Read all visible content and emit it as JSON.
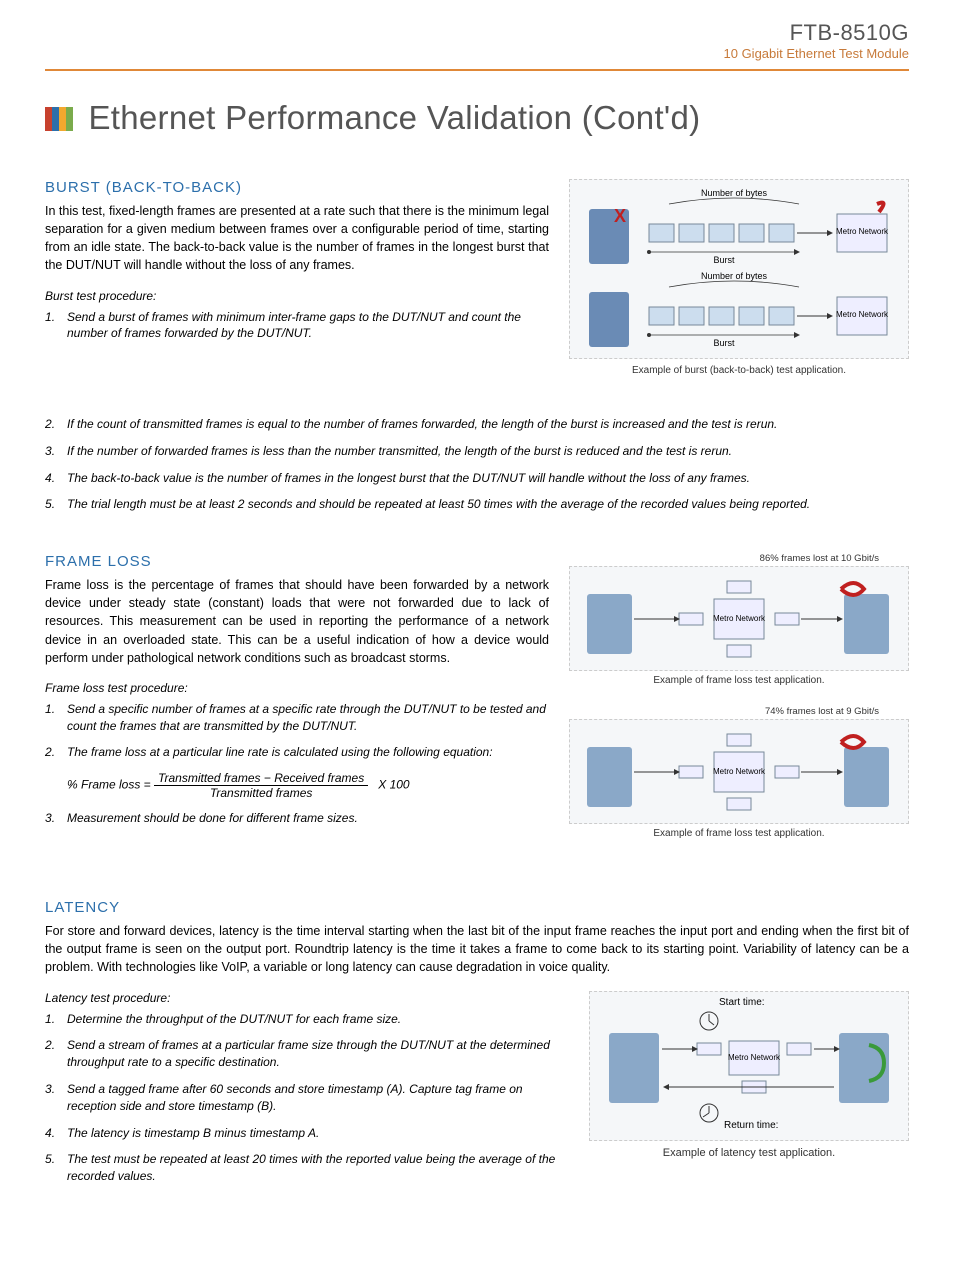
{
  "header": {
    "product_code": "FTB-8510G",
    "product_desc": "10 Gigabit Ethernet Test Module"
  },
  "page_title": "Ethernet Performance Validation (Cont'd)",
  "burst": {
    "heading": "BURST (BACK-TO-BACK)",
    "body": "In this test, fixed-length frames are presented at a rate such that there is the minimum legal separation for a given medium between frames over a configurable period of time, starting from an idle state. The back-to-back value is the number of frames in the longest burst that the DUT/NUT will handle without the loss of any frames.",
    "procedure_title": "Burst test procedure:",
    "steps": [
      "Send a burst of frames with minimum inter-frame gaps to the DUT/NUT and count the number of frames forwarded by the DUT/NUT.",
      "If the count of transmitted frames is equal to the number of frames forwarded, the length of the burst is increased and the test is rerun.",
      "If the number of forwarded frames is less than the number transmitted, the length of the burst is reduced and the test is rerun.",
      "The back-to-back value is the number of frames in the longest burst that the DUT/NUT will handle without the loss of any frames.",
      "The trial length must be at least 2 seconds and should be repeated at least 50 times with the average of the recorded values being reported."
    ],
    "diagram_labels": {
      "top": "Number of bytes",
      "burst": "Burst",
      "metro": "Metro Network"
    },
    "caption": "Example of burst (back-to-back) test application."
  },
  "frame_loss": {
    "heading": "FRAME LOSS",
    "body": "Frame loss is the percentage of frames that should have been forwarded by a network device under steady state (constant) loads that were not forwarded due to lack of resources. This measurement can be used in reporting the performance of a network device in an overloaded state. This can be a useful indication of how a device would perform under pathological network conditions such as broadcast storms.",
    "procedure_title": "Frame loss test procedure:",
    "step1": "Send a specific number of frames at a specific rate through the DUT/NUT to be tested and count the frames that are transmitted by the DUT/NUT.",
    "step2": "The frame loss at a particular line rate is calculated using the following equation:",
    "eq_lhs": "% Frame loss =",
    "eq_num": "Transmitted frames − Received frames",
    "eq_den": "Transmitted frames",
    "eq_tail": "X 100",
    "step3": "Measurement should be done for different frame sizes.",
    "annot1": "86% frames lost at 10 Gbit/s",
    "annot2": "74% frames lost at 9 Gbit/s",
    "metro": "Metro Network",
    "caption1": "Example of frame loss test application.",
    "caption2": "Example of frame loss test application."
  },
  "latency": {
    "heading": "LATENCY",
    "body": "For store and forward devices, latency is the time interval starting when the last bit of the input frame reaches the input port and ending when the first bit of the output frame is seen on the output port. Roundtrip latency is the time it takes a frame to come back to its starting point. Variability of latency can be a problem. With technologies like VoIP, a variable or long latency can cause degradation in voice quality.",
    "procedure_title": "Latency test procedure:",
    "steps": [
      "Determine the throughput of the DUT/NUT for each frame size.",
      "Send a stream of frames at a particular frame size through the DUT/NUT at the determined throughput rate to a specific destination.",
      "Send a tagged frame after 60 seconds and store timestamp (A). Capture tag frame on reception side and store timestamp (B).",
      "The latency is timestamp B minus timestamp A.",
      "The test must be repeated at least 20 times with the reported value being the average of the recorded values."
    ],
    "start_label": "Start time:",
    "return_label": "Return time:",
    "metro": "Metro Network",
    "caption": "Example of latency test application."
  }
}
